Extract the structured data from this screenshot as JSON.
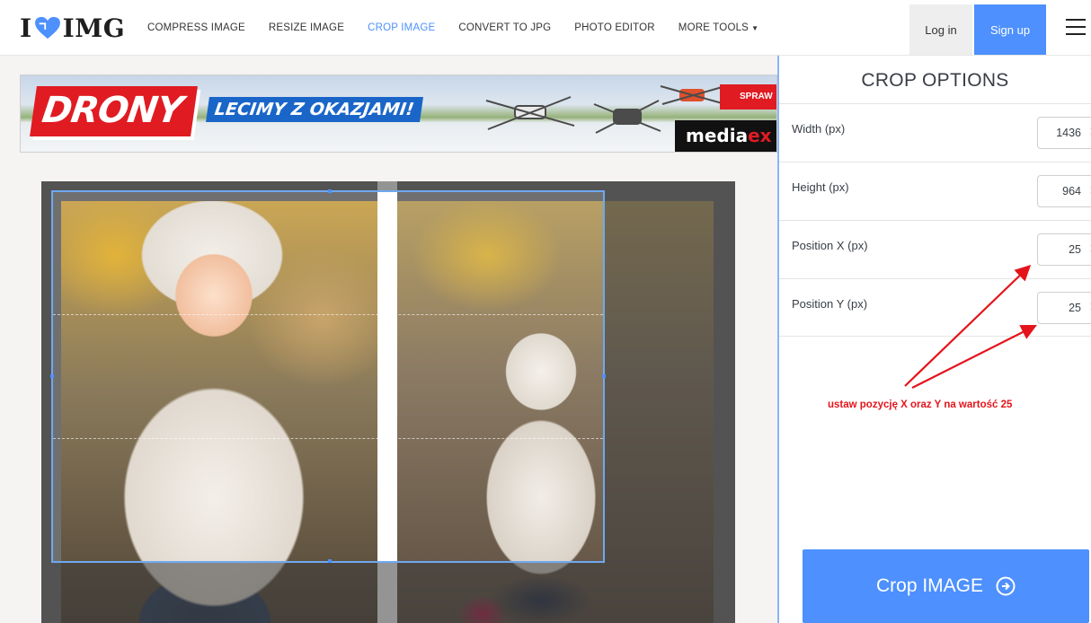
{
  "header": {
    "logo_left": "I",
    "logo_right": "IMG",
    "nav": [
      {
        "label": "COMPRESS IMAGE",
        "active": false
      },
      {
        "label": "RESIZE IMAGE",
        "active": false
      },
      {
        "label": "CROP IMAGE",
        "active": true
      },
      {
        "label": "CONVERT TO JPG",
        "active": false
      },
      {
        "label": "PHOTO EDITOR",
        "active": false
      },
      {
        "label": "MORE TOOLS",
        "active": false
      }
    ],
    "login_label": "Log in",
    "signup_label": "Sign up",
    "menu_icon": "hamburger-icon"
  },
  "banner": {
    "headline": "DRONY",
    "tagline": "LECIMY Z OKAZJAMI!",
    "corner_text": "SPRAW",
    "brand_prefix": "media",
    "brand_suffix": "ex"
  },
  "sidebar": {
    "title": "CROP OPTIONS",
    "options": [
      {
        "label": "Width (px)",
        "value": "1436"
      },
      {
        "label": "Height (px)",
        "value": "964"
      },
      {
        "label": "Position X (px)",
        "value": "25"
      },
      {
        "label": "Position Y (px)",
        "value": "25"
      }
    ],
    "annotation": "ustaw pozycję X oraz Y na wartość 25",
    "crop_button_label": "Crop IMAGE"
  },
  "colors": {
    "accent": "#4d90fe",
    "annotation_red": "#e4141b",
    "logo_heart": "#4d90fe"
  }
}
